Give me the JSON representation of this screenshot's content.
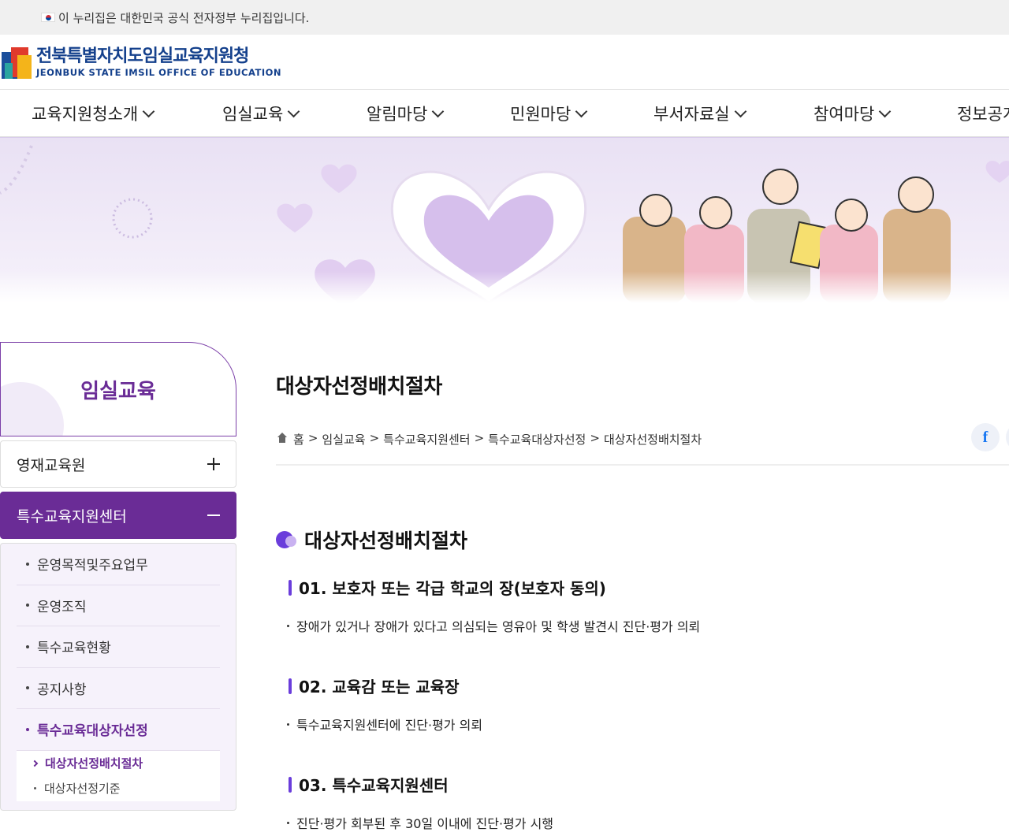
{
  "gov_notice": "이 누리집은 대한민국 공식 전자정부 누리집입니다.",
  "logo": {
    "ko": "전북특별자치도임실교육지원청",
    "en": "JEONBUK STATE IMSIL OFFICE OF EDUCATION"
  },
  "gnb": {
    "items": [
      {
        "label": "교육지원청소개"
      },
      {
        "label": "임실교육"
      },
      {
        "label": "알림마당"
      },
      {
        "label": "민원마당"
      },
      {
        "label": "부서자료실"
      },
      {
        "label": "참여마당"
      },
      {
        "label": "정보공개"
      }
    ]
  },
  "sidebar": {
    "title": "임실교육",
    "menus": [
      {
        "label": "영재교육원",
        "expanded": false
      },
      {
        "label": "특수교육지원센터",
        "expanded": true
      }
    ],
    "sub_items": [
      {
        "label": "운영목적및주요업무"
      },
      {
        "label": "운영조직"
      },
      {
        "label": "특수교육현황"
      },
      {
        "label": "공지사항"
      },
      {
        "label": "특수교육대상자선정"
      }
    ],
    "sub2_items": [
      {
        "label": "대상자선정배치절차"
      },
      {
        "label": "대상자선정기준"
      }
    ]
  },
  "content": {
    "page_title": "대상자선정배치절차",
    "breadcrumb": {
      "home": "홈",
      "path": [
        "임실교육",
        "특수교육지원센터",
        "특수교육대상자선정",
        "대상자선정배치절차"
      ]
    },
    "share": {
      "facebook_glyph": "f"
    },
    "section_title": "대상자선정배치절차",
    "steps": [
      {
        "heading": "01. 보호자 또는 각급 학교의 장(보호자 동의)",
        "text": "장애가 있거나 장애가 있다고 의심되는 영유아 및 학생 발견시 진단·평가 의뢰"
      },
      {
        "heading": "02. 교육감 또는 교육장",
        "text": "특수교육지원센터에 진단·평가 의뢰"
      },
      {
        "heading": "03. 특수교육지원센터",
        "text": "진단·평가 회부된 후 30일 이내에 진단·평가 시행"
      }
    ]
  },
  "colors": {
    "brand_purple": "#6a2c96",
    "logo_blue": "#14408c",
    "accent_violet": "#6a3ddb",
    "banner_bg": "#e9e1f4"
  }
}
